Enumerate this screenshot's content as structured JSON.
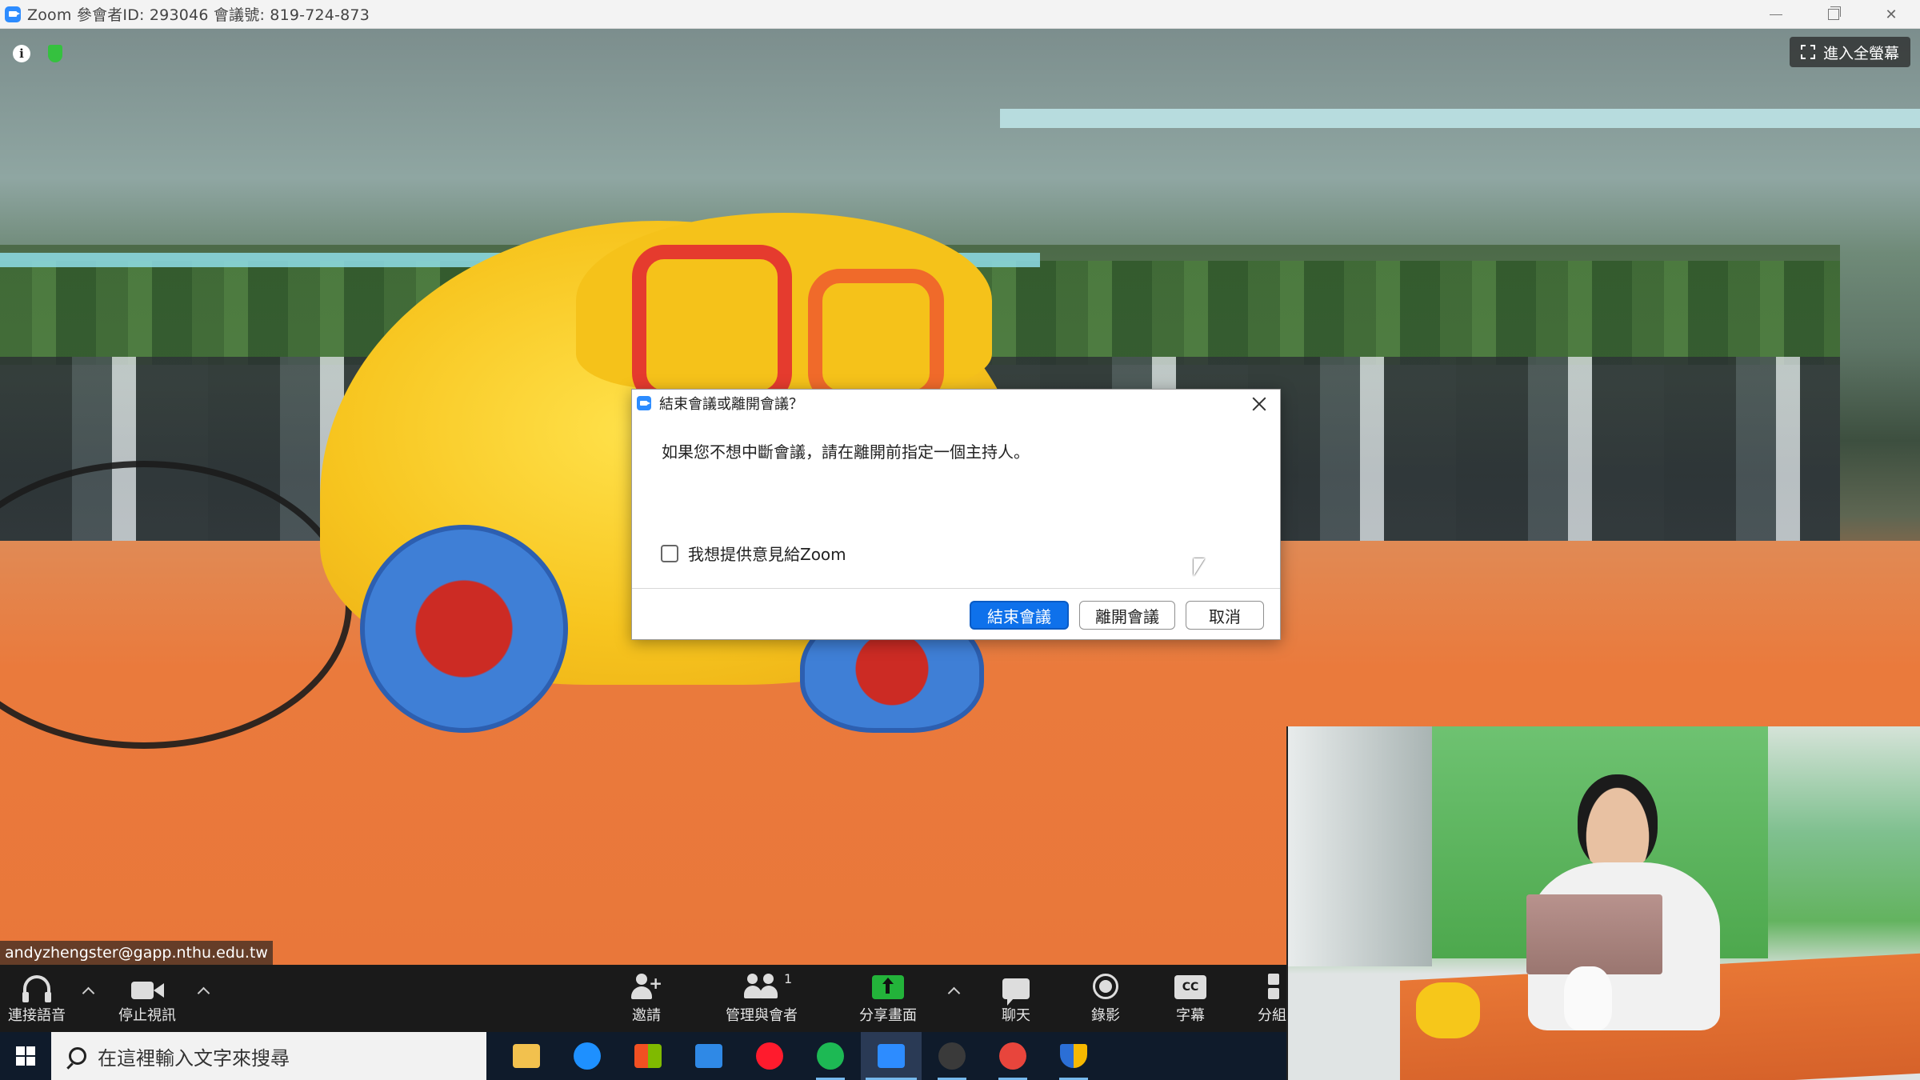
{
  "window": {
    "title": "Zoom 參會者ID: 293046   會議號: 819-724-873",
    "minimize_label": "",
    "restore_label": "",
    "close_label": "✕"
  },
  "meeting": {
    "fullscreen_label": "進入全螢幕",
    "info_icon_glyph": "i",
    "speaker_name": "andyzhengster@gapp.nthu.edu.tw"
  },
  "toolbar": {
    "items": [
      {
        "label": "連接語音",
        "icon": "headphone-icon"
      },
      {
        "label": "停止視訊",
        "icon": "video-camera-icon"
      },
      {
        "label": "邀請",
        "icon": "invite-person-icon"
      },
      {
        "label": "管理與會者",
        "icon": "participants-icon"
      },
      {
        "label": "分享畫面",
        "icon": "share-screen-icon"
      },
      {
        "label": "聊天",
        "icon": "chat-icon"
      },
      {
        "label": "錄影",
        "icon": "record-icon"
      },
      {
        "label": "字幕",
        "icon": "captions-icon"
      },
      {
        "label": "分組",
        "icon": "breakout-rooms-icon"
      }
    ],
    "participant_count": "1",
    "cc_glyph": "CC"
  },
  "dialog": {
    "title": "結束會議或離開會議？",
    "message": "如果您不想中斷會議，請在離開前指定一個主持人。",
    "checkbox_label": "我想提供意見給Zoom",
    "checkbox_checked": false,
    "end_button": "結束會議",
    "leave_button": "離開會議",
    "cancel_button": "取消"
  },
  "taskbar": {
    "search_placeholder": "在這裡輸入文字來搜尋",
    "apps": [
      {
        "name": "file-explorer-icon",
        "color": "#f2c14e"
      },
      {
        "name": "edge-icon",
        "color": "#1e90ff"
      },
      {
        "name": "store-icon",
        "color": "#ffffff"
      },
      {
        "name": "mail-icon",
        "color": "#2f89e6"
      },
      {
        "name": "opera-icon",
        "color": "#ff1b2d"
      },
      {
        "name": "spotify-icon",
        "color": "#1db954"
      },
      {
        "name": "zoom-icon",
        "color": "#2d8cff"
      },
      {
        "name": "obs-icon",
        "color": "#3a3a3a"
      },
      {
        "name": "chrome-icon",
        "color": "#e8453c"
      },
      {
        "name": "security-shield-icon",
        "color": "#f6b800"
      }
    ]
  },
  "colors": {
    "zoom_blue": "#0e71eb",
    "share_green": "#23b33a",
    "toolbar_bg": "#1a1a1a",
    "taskbar_bg": "#0f1b2b"
  }
}
